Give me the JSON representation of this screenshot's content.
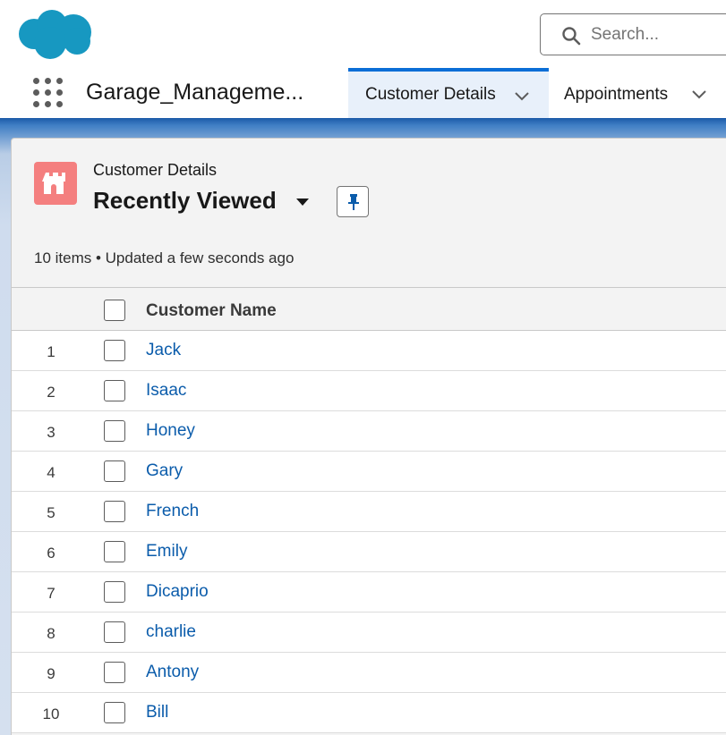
{
  "header": {
    "logo": "cloud-logo",
    "search_placeholder": "Search...",
    "app_name": "Garage_Manageme...",
    "tabs": [
      {
        "label": "Customer Details",
        "active": true
      },
      {
        "label": "Appointments",
        "active": false
      }
    ]
  },
  "list_view": {
    "object_label": "Customer Details",
    "title": "Recently Viewed",
    "meta": "10 items • Updated a few seconds ago",
    "column_header": "Customer Name",
    "rows": [
      {
        "num": "1",
        "name": "Jack"
      },
      {
        "num": "2",
        "name": "Isaac"
      },
      {
        "num": "3",
        "name": "Honey"
      },
      {
        "num": "4",
        "name": "Gary"
      },
      {
        "num": "5",
        "name": "French"
      },
      {
        "num": "6",
        "name": "Emily"
      },
      {
        "num": "7",
        "name": "Dicaprio"
      },
      {
        "num": "8",
        "name": "charlie"
      },
      {
        "num": "9",
        "name": "Antony"
      },
      {
        "num": "10",
        "name": "Bill"
      }
    ]
  },
  "colors": {
    "accent": "#0b6ed6",
    "link": "#0b5cab",
    "object_icon": "#f47f7f",
    "logo": "#1798c1"
  },
  "icons": [
    "cloud-logo",
    "search-icon",
    "app-launcher-icon",
    "chevron-down-icon",
    "castle-icon",
    "caret-down-icon",
    "pin-icon",
    "checkbox"
  ]
}
